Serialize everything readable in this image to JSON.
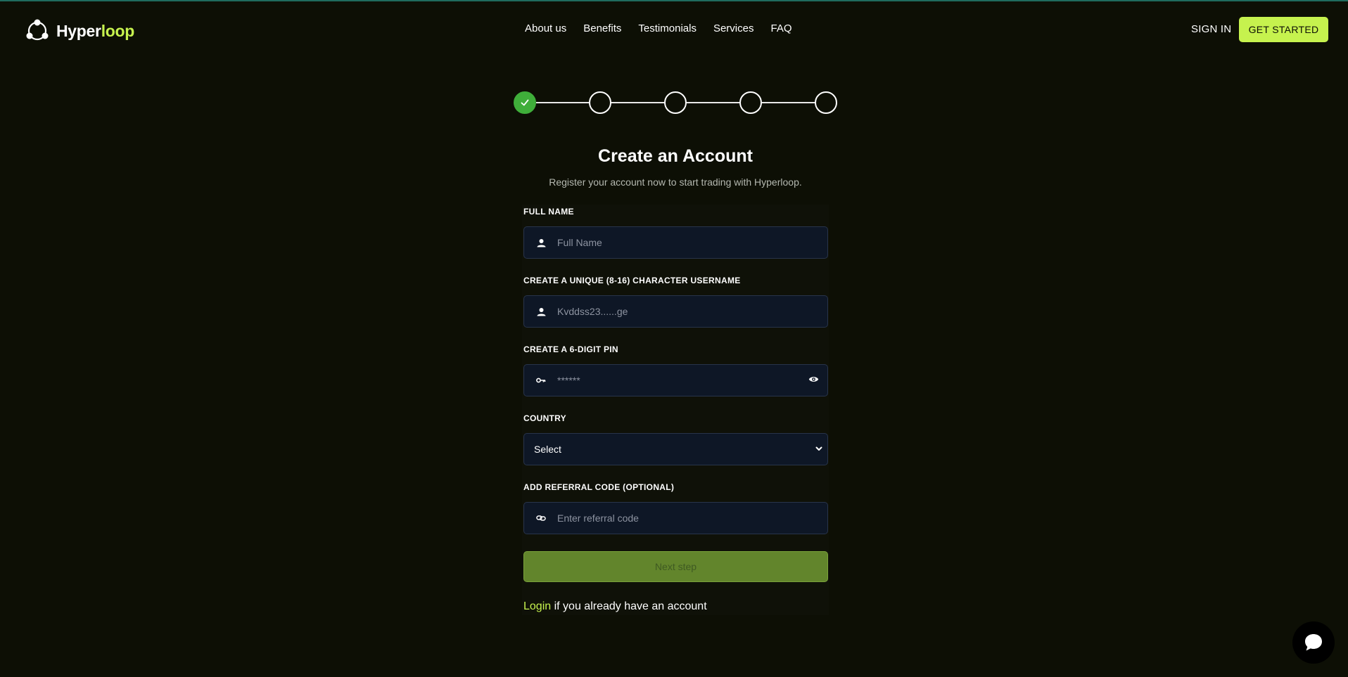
{
  "header": {
    "logo_text_main": "Hyper",
    "logo_text_accent": "loop",
    "nav": [
      "About us",
      "Benefits",
      "Testimonials",
      "Services",
      "FAQ"
    ],
    "signin_label": "SIGN IN",
    "get_started_label": "GET STARTED"
  },
  "stepper": {
    "total_steps": 5,
    "completed_steps": 1
  },
  "form": {
    "title": "Create an Account",
    "subtitle": "Register your account now to start trading with Hyperloop.",
    "full_name": {
      "label": "FULL NAME",
      "placeholder": "Full Name",
      "icon": "user-icon"
    },
    "username": {
      "label": "CREATE A UNIQUE (8-16) CHARACTER USERNAME",
      "placeholder": "Kvddss23......ge",
      "icon": "user-icon"
    },
    "pin": {
      "label": "CREATE A 6-DIGIT PIN",
      "placeholder": "******",
      "icon": "key-icon",
      "toggle_icon": "eye-icon"
    },
    "country": {
      "label": "COUNTRY",
      "selected": "Select",
      "icon": "chevron-down-icon"
    },
    "referral": {
      "label": "ADD REFERRAL CODE (OPTIONAL)",
      "placeholder": "Enter referral code",
      "icon": "link-icon"
    },
    "next_label": "Next step",
    "login_link": "Login",
    "login_rest": " if you already have an account"
  },
  "colors": {
    "background": "#0d0f05",
    "accent": "#c6f24e",
    "step_done": "#3fae3a",
    "input_bg": "#0e1726",
    "button_disabled": "#62852c"
  }
}
